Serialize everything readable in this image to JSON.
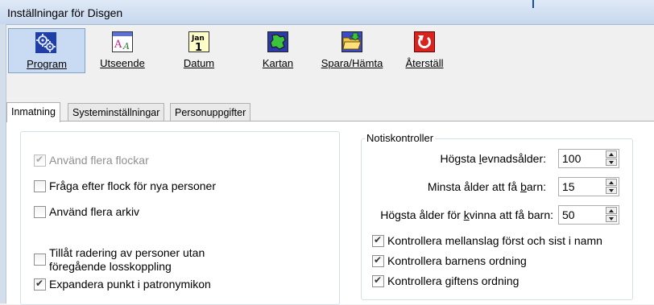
{
  "window": {
    "title": "Inställningar för Disgen"
  },
  "toolbar": {
    "buttons": [
      {
        "label": "Program",
        "icon": "gears-icon"
      },
      {
        "label": "Utseende",
        "icon": "font-appearance-icon"
      },
      {
        "label": "Datum",
        "icon": "calendar-icon"
      },
      {
        "label": "Kartan",
        "icon": "map-icon"
      },
      {
        "label": "Spara/Hämta",
        "icon": "folder-save-icon"
      },
      {
        "label": "Återställ",
        "icon": "reset-icon"
      }
    ]
  },
  "tabs": [
    "Inmatning",
    "Systeminställningar",
    "Personuppgifter"
  ],
  "left_group": {
    "checkboxes": [
      {
        "label": "Använd flera flockar",
        "checked": true,
        "disabled": true
      },
      {
        "label": "Fråga efter flock för nya personer",
        "checked": false
      },
      {
        "label": "Använd flera arkiv",
        "checked": false
      },
      {
        "label_line1": "Tillåt radering av personer utan",
        "label_line2": "föregående losskoppling",
        "checked": false
      },
      {
        "label": "Expandera punkt i patronymikon",
        "checked": true
      }
    ]
  },
  "notis": {
    "legend": "Notiskontroller",
    "spinners": [
      {
        "label_pre": "Högsta ",
        "label_u": "l",
        "label_post": "evnadsålder:",
        "value": "100"
      },
      {
        "label_pre": "Minsta ålder att få ",
        "label_u": "b",
        "label_post": "arn:",
        "value": "15"
      },
      {
        "label_pre": "Högsta ålder för ",
        "label_u": "k",
        "label_post": "vinna att få barn:",
        "value": "50"
      }
    ],
    "checkboxes": [
      {
        "label": "Kontrollera mellanslag först och sist i namn",
        "checked": true
      },
      {
        "label": "Kontrollera barnens ordning",
        "checked": true
      },
      {
        "label": "Kontrollera giftens ordning",
        "checked": true
      }
    ]
  }
}
